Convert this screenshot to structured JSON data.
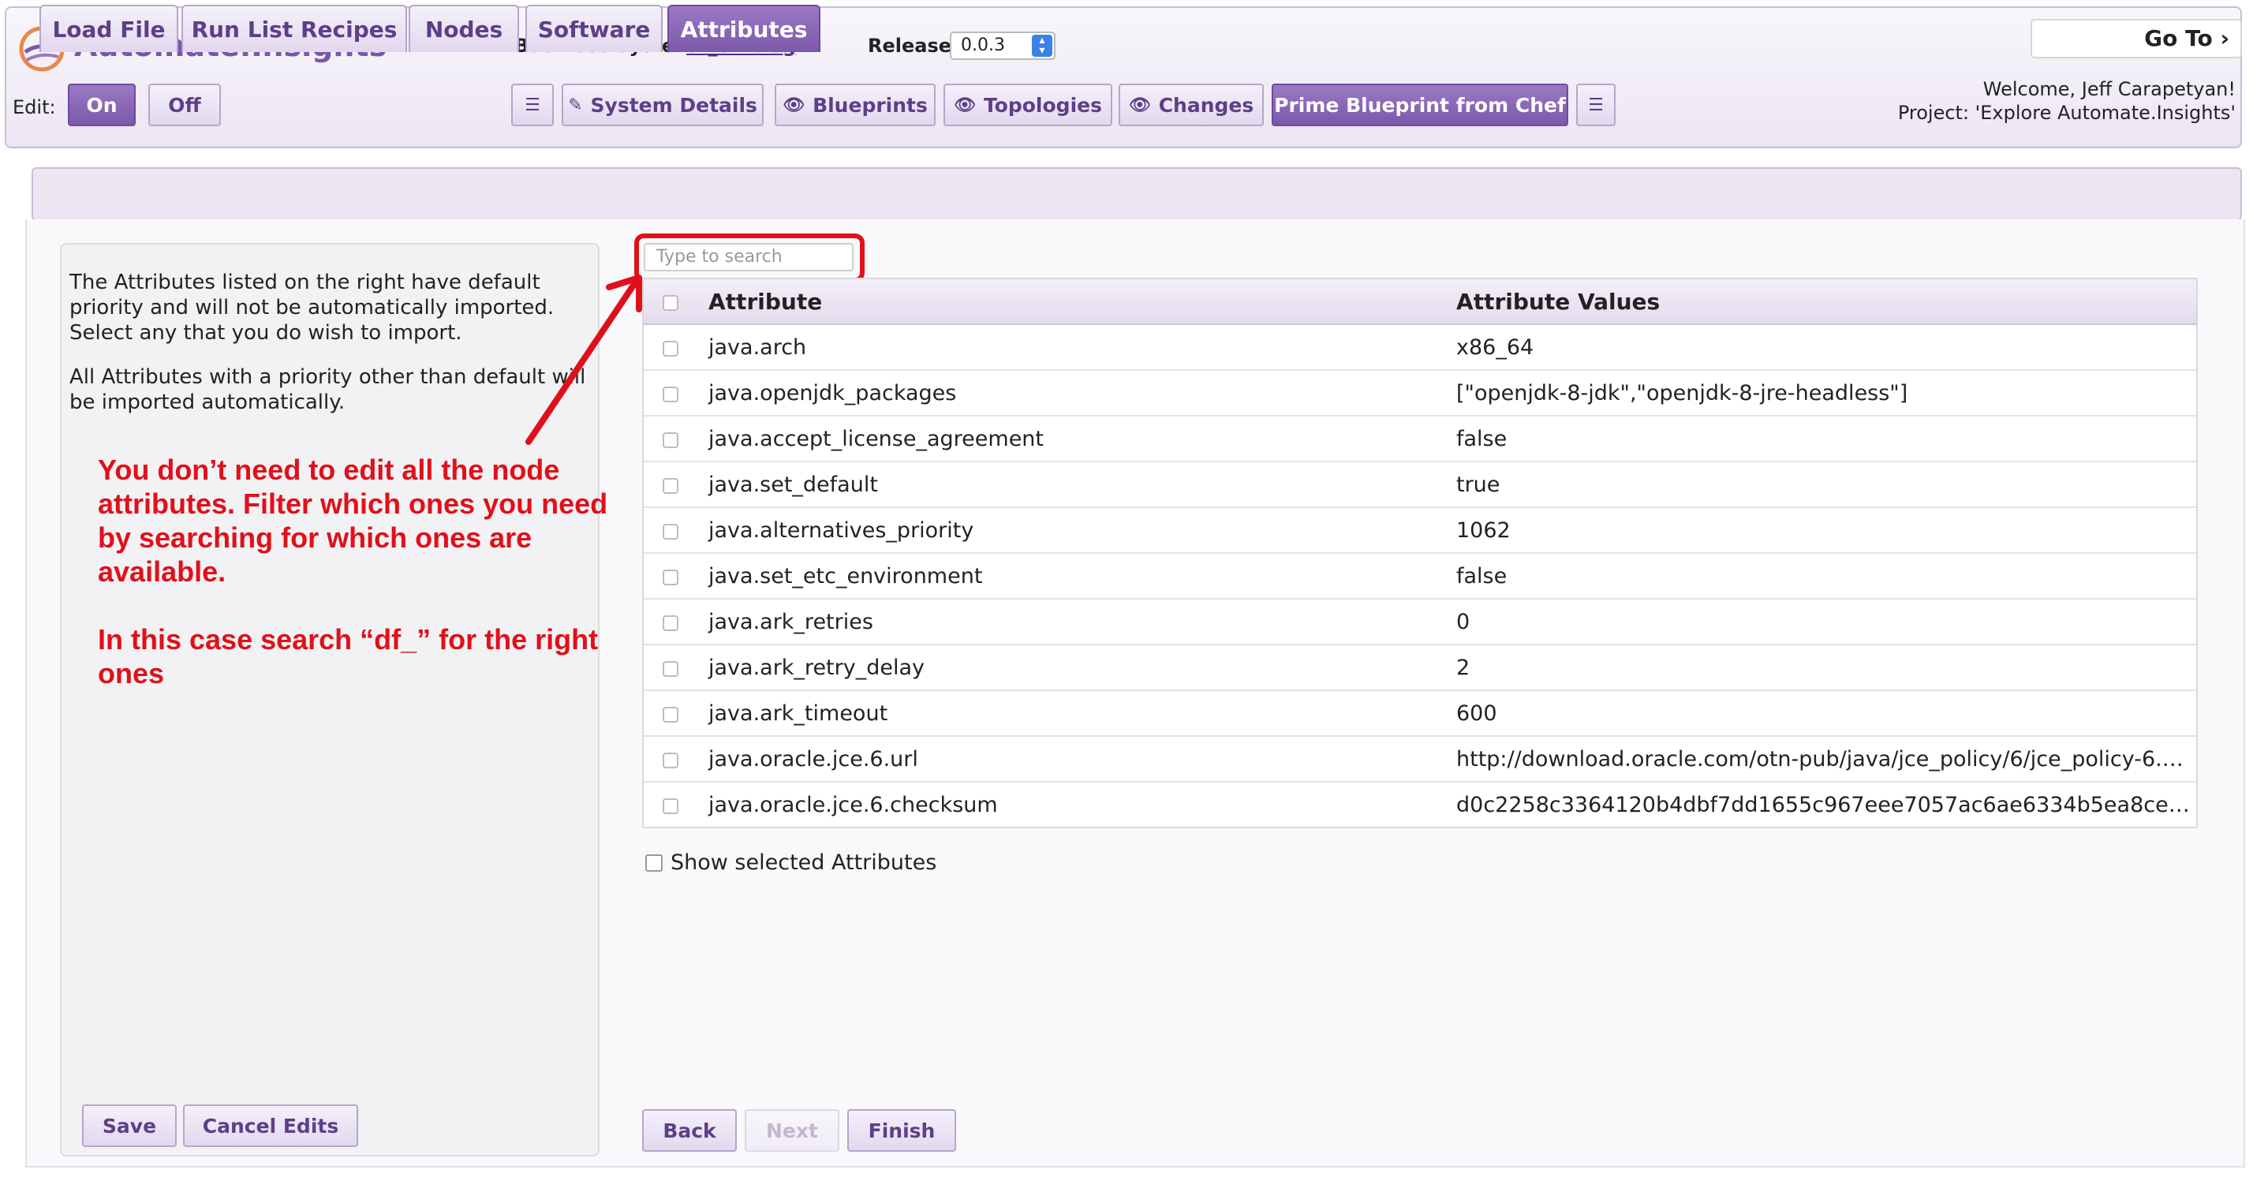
{
  "header": {
    "app_title": "Automate.Insights",
    "edit_label": "Edit:",
    "edit_on": "On",
    "edit_off": "Off",
    "business_system_label": "Business System:",
    "business_system_value": "df_elkblog",
    "release_label": "Release",
    "release_value": "0.0.3",
    "goto_label": "Go To",
    "welcome": "Welcome, Jeff Carapetyan!",
    "project": "Project: 'Explore Automate.Insights'"
  },
  "toolbar": {
    "system_details": "System Details",
    "blueprints": "Blueprints",
    "topologies": "Topologies",
    "changes": "Changes",
    "prime_blueprint": "Prime Blueprint from Chef"
  },
  "tabs": [
    "Load File",
    "Run List Recipes",
    "Nodes",
    "Software",
    "Attributes"
  ],
  "active_tab": "Attributes",
  "left_panel": {
    "para1": "The Attributes listed on the right have default priority and will not be automatically imported. Select any that you do wish to import.",
    "para2": "All Attributes with a priority other than default will be imported automatically.",
    "save": "Save",
    "cancel": "Cancel Edits"
  },
  "annotation": {
    "line1": "You don’t need to edit all the node attributes. Filter which ones you need by searching for which ones are available.",
    "line2": "In this case search “df_” for the right ones"
  },
  "search": {
    "placeholder": "Type to search"
  },
  "table": {
    "col_attribute": "Attribute",
    "col_values": "Attribute Values",
    "rows": [
      {
        "attribute": "java.arch",
        "value": "x86_64"
      },
      {
        "attribute": "java.openjdk_packages",
        "value": "[\"openjdk-8-jdk\",\"openjdk-8-jre-headless\"]"
      },
      {
        "attribute": "java.accept_license_agreement",
        "value": "false"
      },
      {
        "attribute": "java.set_default",
        "value": "true"
      },
      {
        "attribute": "java.alternatives_priority",
        "value": "1062"
      },
      {
        "attribute": "java.set_etc_environment",
        "value": "false"
      },
      {
        "attribute": "java.ark_retries",
        "value": "0"
      },
      {
        "attribute": "java.ark_retry_delay",
        "value": "2"
      },
      {
        "attribute": "java.ark_timeout",
        "value": "600"
      },
      {
        "attribute": "java.oracle.jce.6.url",
        "value": "http://download.oracle.com/otn-pub/java/jce_policy/6/jce_policy-6.…"
      },
      {
        "attribute": "java.oracle.jce.6.checksum",
        "value": "d0c2258c3364120b4dbf7dd1655c967eee7057ac6ae6334b5ea8ceb8…"
      }
    ]
  },
  "show_selected": "Show selected Attributes",
  "nav": {
    "back": "Back",
    "next": "Next",
    "finish": "Finish"
  },
  "colors": {
    "accent": "#7c58aa",
    "annotation": "#e0101a"
  }
}
